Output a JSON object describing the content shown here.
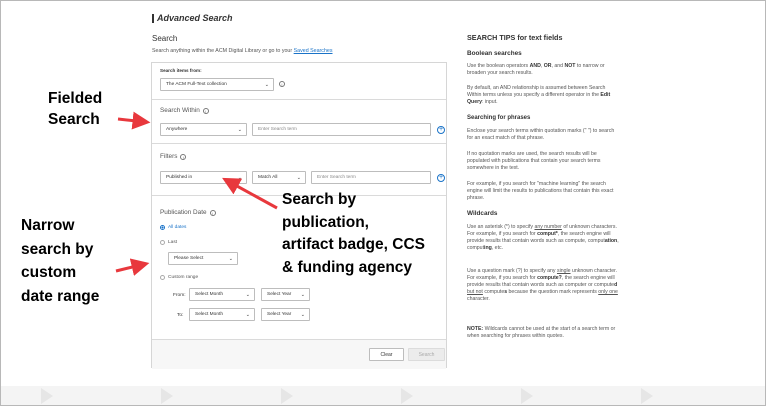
{
  "header": {
    "title": "Advanced Search"
  },
  "search": {
    "heading": "Search",
    "subtitle_prefix": "Search anything within the ACM Digital Library or go to your ",
    "saved_searches_link": "Saved Searches",
    "search_items_from_label": "Search items from:",
    "collection_value": "The ACM Full-Text collection"
  },
  "search_within": {
    "title": "Search Within",
    "field_value": "Anywhere",
    "term_placeholder": "Enter Search term"
  },
  "filters": {
    "title": "Filters",
    "field_value": "Published in",
    "match_value": "Match All",
    "term_placeholder": "Enter Search term"
  },
  "publication_date": {
    "title": "Publication Date",
    "all_dates": "All dates",
    "last": "Last",
    "please_select": "Please Select",
    "custom_range": "Custom range",
    "from_label": "From:",
    "to_label": "To:",
    "select_month": "Select Month",
    "select_year": "Select Year"
  },
  "buttons": {
    "clear": "Clear",
    "search": "Search"
  },
  "tips": {
    "title": "SEARCH TIPS for text fields",
    "boolean_heading": "Boolean searches",
    "boolean_p1_a": "Use the boolean operators ",
    "boolean_p1_and": "AND",
    "boolean_p1_b": ", ",
    "boolean_p1_or": "OR",
    "boolean_p1_c": ", and ",
    "boolean_p1_not": "NOT",
    "boolean_p1_d": " to narrow or broaden your search results.",
    "boolean_p2_a": "By default, an AND relationship is assumed between Search Within terms unless you specify a different operator in the ",
    "boolean_p2_b": "Edit Query",
    "boolean_p2_c": ": input.",
    "phrases_heading": "Searching for phrases",
    "phrases_p1": "Enclose your search terms within quotation marks (\" \") to search for an exact match of that phrase.",
    "phrases_p2": "If no quotation marks are used, the search results will be populated with publications that contain your search terms somewhere in the text.",
    "phrases_p3": "For example, if you search for \"machine learning\" the search engine will limit the results to publications that contain this exact phrase.",
    "wildcards_heading": "Wildcards",
    "wild_p1_a": "Use an asterisk (*) to specify ",
    "wild_p1_u": "any number",
    "wild_p1_b": " of unknown characters. For example, if you search for ",
    "wild_p1_c": "comput*",
    "wild_p1_d": ", the search engine will provide results that contain words such as compute, comput",
    "wild_p1_e": "ation",
    "wild_p1_f": ", comput",
    "wild_p1_g": "ing",
    "wild_p1_h": ", etc.",
    "wild_p2_a": "Use a question mark (?) to specify any ",
    "wild_p2_u": "single",
    "wild_p2_b": " unknown character. For example, if you search for ",
    "wild_p2_c": "compute?",
    "wild_p2_d": ", the search engine will provide results that contain words such as computer or compute",
    "wild_p2_e": "d",
    "wild_p2_f": " ",
    "wild_p2_g": "but not",
    "wild_p2_h": " compute",
    "wild_p2_i": "s",
    "wild_p2_j": " because the question mark represents ",
    "wild_p2_k": "only one",
    "wild_p2_l": " character.",
    "note_label": "NOTE:",
    "note_text": " Wildcards cannot be used at the start of a search term or when searching for phrases within quotes."
  },
  "callouts": {
    "fielded_1": "Fielded",
    "fielded_2": "Search",
    "narrow_1": "Narrow",
    "narrow_2": "search by",
    "narrow_3": "custom",
    "narrow_4": "date range",
    "pub_1": "Search by",
    "pub_2": "publication,",
    "pub_3": "artifact badge, CCS",
    "pub_4": "& funding agency"
  },
  "colors": {
    "accent": "#1a73c8",
    "arrow": "#e8383d",
    "border": "#d6d6d6"
  },
  "icons": [
    "info-icon",
    "chevron-down-icon",
    "plus-circle-icon",
    "radio-icon",
    "arrow-icon"
  ]
}
